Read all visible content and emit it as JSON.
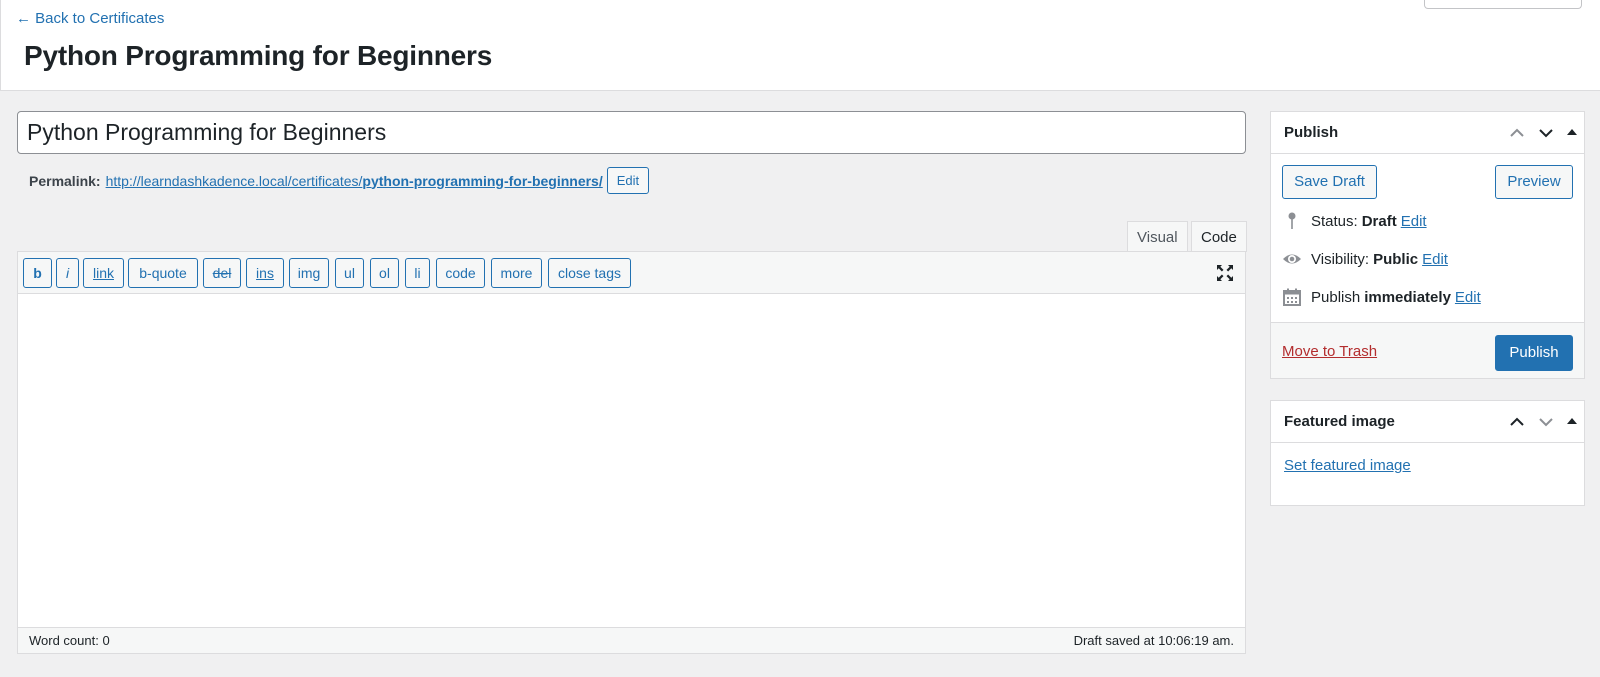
{
  "header": {
    "back_link": "← Back to Certificates",
    "page_title": "Python Programming for Beginners"
  },
  "post": {
    "title": "Python Programming for Beginners",
    "permalink_label": "Permalink:",
    "permalink_base": "http://learndashkadence.local/certificates/",
    "permalink_slug": "python-programming-for-beginners/",
    "permalink_edit": "Edit"
  },
  "editor": {
    "tabs": {
      "visual": "Visual",
      "code": "Code",
      "active": "Code"
    },
    "quicktags": [
      "b",
      "i",
      "link",
      "b-quote",
      "del",
      "ins",
      "img",
      "ul",
      "ol",
      "li",
      "code",
      "more",
      "close tags"
    ],
    "content": "",
    "word_count": "Word count: 0",
    "draft_saved": "Draft saved at 10:06:19 am."
  },
  "publish_box": {
    "title": "Publish",
    "save_draft": "Save Draft",
    "preview": "Preview",
    "status_label": "Status:",
    "status_value": "Draft",
    "visibility_label": "Visibility:",
    "visibility_value": "Public",
    "publish_label": "Publish",
    "publish_value": "immediately",
    "edit_label": "Edit",
    "trash": "Move to Trash",
    "publish_button": "Publish"
  },
  "featured_image_box": {
    "title": "Featured image",
    "set_link": "Set featured image"
  },
  "icons": {
    "status": "pin-icon",
    "visibility": "eye-icon",
    "publish": "calendar-icon",
    "fullscreen": "fullscreen-icon"
  },
  "colors": {
    "accent": "#2271b1",
    "trash": "#b32d2e",
    "background": "#f0f0f1"
  }
}
